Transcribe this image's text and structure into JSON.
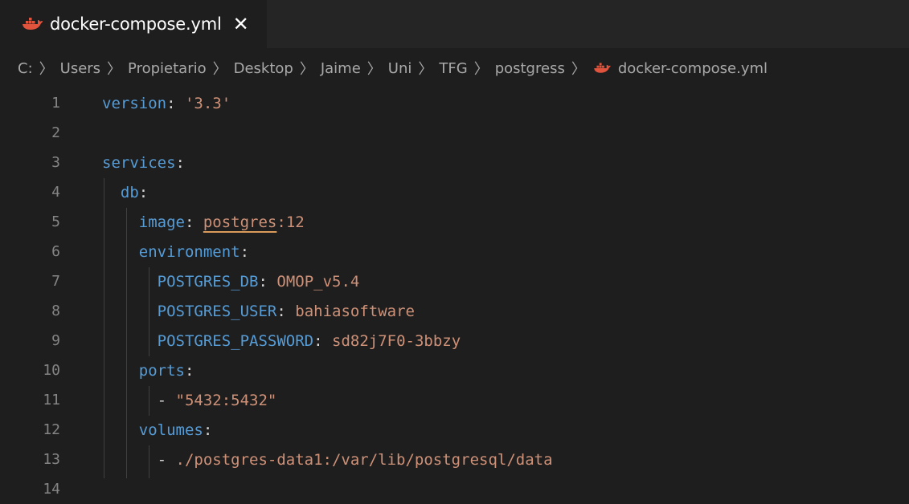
{
  "tab": {
    "title": "docker-compose.yml",
    "close": "✕",
    "icon": "docker-whale-icon"
  },
  "breadcrumb": {
    "items": [
      "C:",
      "Users",
      "Propietario",
      "Desktop",
      "Jaime",
      "Uni",
      "TFG",
      "postgress",
      "docker-compose.yml"
    ]
  },
  "lines": [
    {
      "n": "1",
      "parts": [
        [
          "key",
          "version"
        ],
        [
          "plain",
          ": "
        ],
        [
          "str",
          "'3.3'"
        ]
      ]
    },
    {
      "n": "2",
      "parts": []
    },
    {
      "n": "3",
      "parts": [
        [
          "key",
          "services"
        ],
        [
          "plain",
          ":"
        ]
      ]
    },
    {
      "n": "4",
      "parts": [
        [
          "plain",
          "  "
        ],
        [
          "key",
          "db"
        ],
        [
          "plain",
          ":"
        ]
      ]
    },
    {
      "n": "5",
      "parts": [
        [
          "plain",
          "    "
        ],
        [
          "key",
          "image"
        ],
        [
          "plain",
          ": "
        ],
        [
          "valu",
          "postgres"
        ],
        [
          "val",
          ":12"
        ]
      ]
    },
    {
      "n": "6",
      "parts": [
        [
          "plain",
          "    "
        ],
        [
          "key",
          "environment"
        ],
        [
          "plain",
          ":"
        ]
      ]
    },
    {
      "n": "7",
      "parts": [
        [
          "plain",
          "      "
        ],
        [
          "key",
          "POSTGRES_DB"
        ],
        [
          "plain",
          ": "
        ],
        [
          "val",
          "OMOP_v5.4"
        ]
      ]
    },
    {
      "n": "8",
      "parts": [
        [
          "plain",
          "      "
        ],
        [
          "key",
          "POSTGRES_USER"
        ],
        [
          "plain",
          ": "
        ],
        [
          "val",
          "bahiasoftware"
        ]
      ]
    },
    {
      "n": "9",
      "parts": [
        [
          "plain",
          "      "
        ],
        [
          "key",
          "POSTGRES_PASSWORD"
        ],
        [
          "plain",
          ": "
        ],
        [
          "val",
          "sd82j7F0-3bbzy"
        ]
      ]
    },
    {
      "n": "10",
      "parts": [
        [
          "plain",
          "    "
        ],
        [
          "key",
          "ports"
        ],
        [
          "plain",
          ":"
        ]
      ]
    },
    {
      "n": "11",
      "parts": [
        [
          "plain",
          "      - "
        ],
        [
          "str",
          "\"5432:5432\""
        ]
      ]
    },
    {
      "n": "12",
      "parts": [
        [
          "plain",
          "    "
        ],
        [
          "key",
          "volumes"
        ],
        [
          "plain",
          ":"
        ]
      ]
    },
    {
      "n": "13",
      "parts": [
        [
          "plain",
          "      - "
        ],
        [
          "val",
          "./postgres-data1:/var/lib/postgresql/data"
        ]
      ]
    },
    {
      "n": "14",
      "parts": []
    }
  ],
  "colors": {
    "key": "#569cd6",
    "string": "#ce9178",
    "background": "#1e1e1e",
    "line_number": "#858585"
  }
}
